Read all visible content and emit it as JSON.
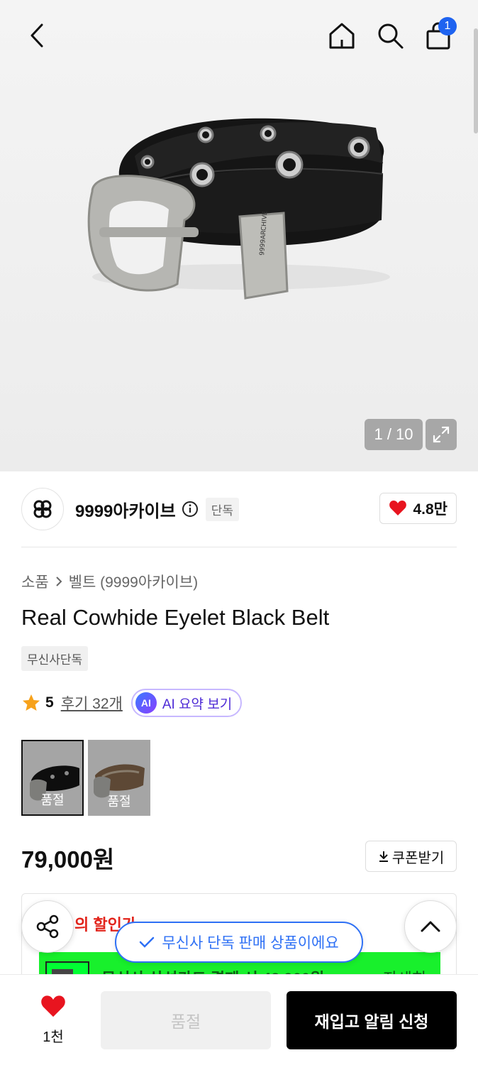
{
  "header": {
    "back_icon": "chevron-left-icon",
    "home_icon": "home-icon",
    "search_icon": "search-icon",
    "cart_icon": "shopping-bag-icon",
    "cart_count": "1"
  },
  "gallery": {
    "page_indicator": "1 / 10",
    "expand_icon": "expand-icon",
    "belt_stamp": "9999ARCHIVE"
  },
  "brand": {
    "name": "9999아카이브",
    "exclusive_tag": "단독",
    "like_count": "4.8만"
  },
  "product": {
    "breadcrumb": [
      "소품",
      "벨트 (9999아카이브)"
    ],
    "title": "Real Cowhide Eyelet Black Belt",
    "exclusive_badge": "무신사단독",
    "rating": "5",
    "review_link": "후기 32개",
    "ai_badge": "AI",
    "ai_summary": "AI 요약 보기",
    "options": [
      {
        "label": "품절",
        "selected": true
      },
      {
        "label": "품절",
        "selected": false
      }
    ],
    "price": "79,000원",
    "coupon_button": "쿠폰받기"
  },
  "discount": {
    "title": "의 할인가",
    "promo_text": "무신사 삼성카드 결제 시 42,960원",
    "promo_detail": "자세히"
  },
  "toast": "무신사 단독 판매 상품이에요",
  "bottom_bar": {
    "wish_count": "1천",
    "soldout_label": "품절",
    "restock_label": "재입고 알림 신청"
  },
  "colors": {
    "accent_blue": "#2e70f5",
    "heart_red": "#e8141f",
    "promo_green": "#18f02c",
    "primary_button": "#000000"
  }
}
